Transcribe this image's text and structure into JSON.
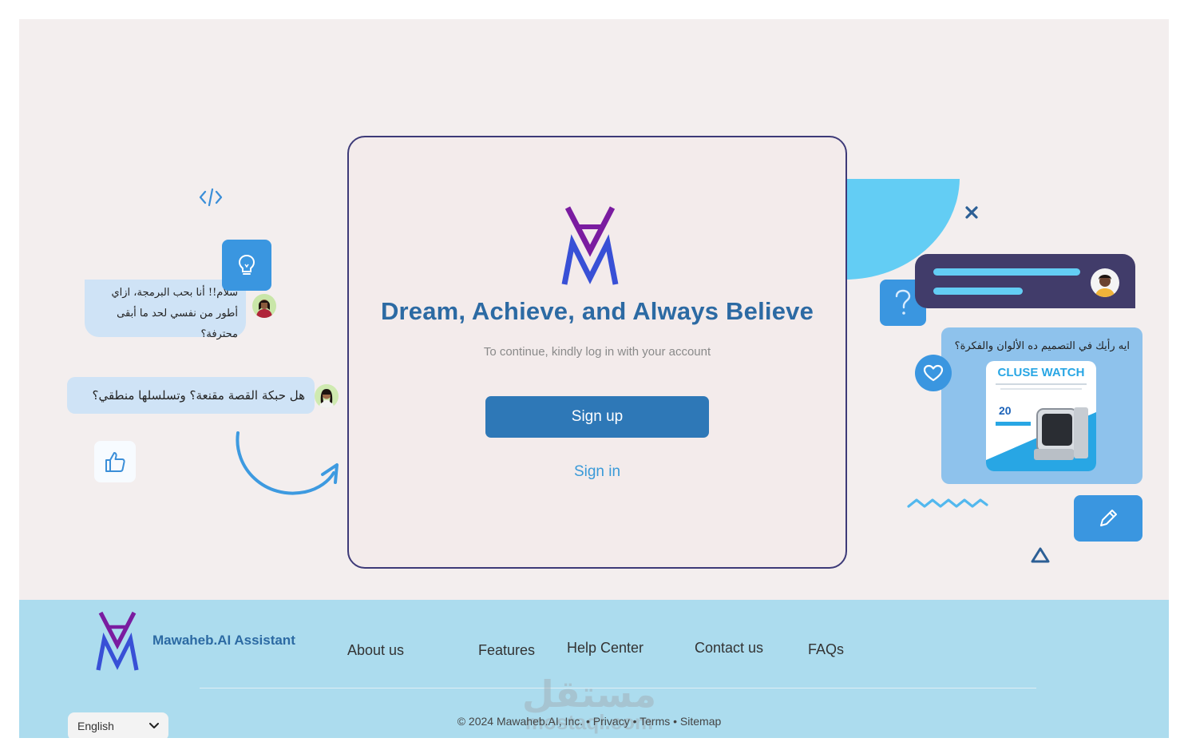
{
  "card": {
    "headline": "Dream, Achieve, and Always Believe",
    "subline": "To continue, kindly log in with your account",
    "signup_label": "Sign up",
    "signin_label": "Sign in"
  },
  "chat": {
    "bubble1": "سلام!! أنا بحب البرمجة، ازاي أطور من نفسي لحد ما أبقى محترفة؟",
    "bubble2": "هل حبكة القصة مقنعة؟ وتسلسلها منطقي؟",
    "design_question": "ايه رأيك في التصميم ده الألوان والفكرة؟",
    "ad_title": "CLUSE WATCH",
    "ad_discount": "20"
  },
  "footer": {
    "brand": "Mawaheb.AI Assistant",
    "nav": [
      "About us",
      "Features",
      "Help Center",
      "Contact us",
      "FAQs"
    ],
    "copyright": "© 2024 Mawaheb.AI, Inc. • Privacy • Terms • Sitemap",
    "language": "English",
    "watermark": "مستقل",
    "watermark_sub": "mostaql.com"
  },
  "colors": {
    "page_bg": "#f3eeee",
    "footer_bg": "#acdcee",
    "brand_blue": "#2c6aa3",
    "button_blue": "#2e78b7",
    "logo_purple": "#7a1ca0",
    "logo_blue": "#3850d6",
    "accent_cyan": "#63cdf4"
  },
  "icons": [
    "code-icon",
    "lightbulb-icon",
    "thumbs-up-icon",
    "curved-arrow-icon",
    "close-icon",
    "question-icon",
    "heart-icon",
    "pencil-icon",
    "triangle-icon",
    "zigzag-icon",
    "chevron-down-icon"
  ]
}
